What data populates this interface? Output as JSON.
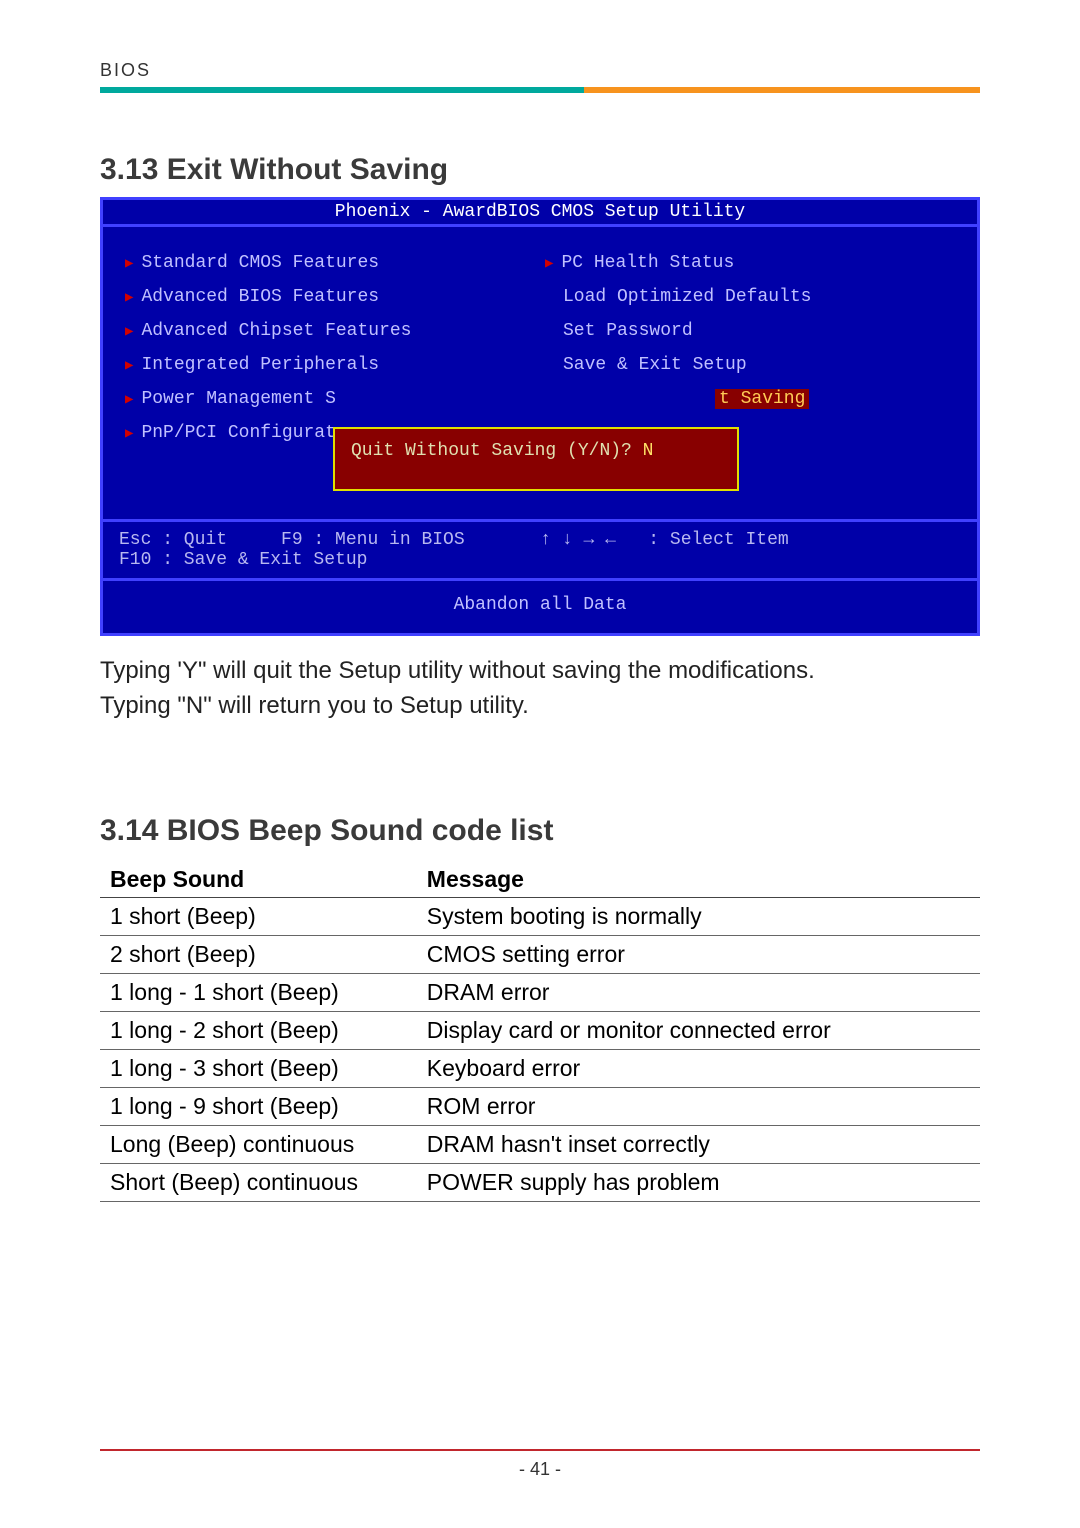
{
  "header": {
    "label": "BIOS"
  },
  "section1": {
    "title": "3.13 Exit Without Saving",
    "bios": {
      "title": "Phoenix - AwardBIOS CMOS Setup Utility",
      "left_items": [
        {
          "label": "Standard CMOS Features",
          "tri": true
        },
        {
          "label": "Advanced BIOS Features",
          "tri": true
        },
        {
          "label": "Advanced Chipset Features",
          "tri": true
        },
        {
          "label": "Integrated Peripherals",
          "tri": true
        },
        {
          "label": "Power Management S",
          "tri": true
        },
        {
          "label": "PnP/PCI Configurat",
          "tri": true
        }
      ],
      "right_items": [
        {
          "label": "PC Health Status",
          "tri": true
        },
        {
          "label": "Load Optimized Defaults",
          "tri": false
        },
        {
          "label": "Set Password",
          "tri": false
        },
        {
          "label": "Save & Exit Setup",
          "tri": false
        },
        {
          "label": "t Saving",
          "tri": false,
          "highlight": true
        }
      ],
      "popup_text": "Quit Without Saving (Y/N)?",
      "popup_answer": "N",
      "help_line1": "Esc : Quit     F9 : Menu in BIOS       ↑ ↓ → ←   : Select Item",
      "help_line2": "F10 : Save & Exit Setup",
      "footer": "Abandon all Data"
    },
    "body1": "Typing 'Y\" will quit the Setup utility without saving the modifications.",
    "body2": "Typing \"N\" will return you to Setup utility."
  },
  "section2": {
    "title": "3.14 BIOS Beep Sound code list",
    "headers": {
      "c1": "Beep Sound",
      "c2": "Message"
    },
    "rows": [
      {
        "sound": "1 short (Beep)",
        "msg": "System booting is normally"
      },
      {
        "sound": "2 short (Beep)",
        "msg": "CMOS setting error"
      },
      {
        "sound": "1 long - 1 short (Beep)",
        "msg": "DRAM error"
      },
      {
        "sound": "1 long - 2 short (Beep)",
        "msg": "Display card or monitor connected error"
      },
      {
        "sound": "1 long - 3 short (Beep)",
        "msg": "Keyboard error"
      },
      {
        "sound": "1 long - 9 short (Beep)",
        "msg": "ROM error"
      },
      {
        "sound": "Long (Beep) continuous",
        "msg": "DRAM hasn't inset correctly"
      },
      {
        "sound": "Short (Beep) continuous",
        "msg": "POWER supply has problem"
      }
    ]
  },
  "page_number": "41",
  "chart_data": {
    "type": "table",
    "title": "BIOS Beep Sound code list",
    "columns": [
      "Beep Sound",
      "Message"
    ],
    "rows": [
      [
        "1 short (Beep)",
        "System booting is normally"
      ],
      [
        "2 short (Beep)",
        "CMOS setting error"
      ],
      [
        "1 long - 1 short (Beep)",
        "DRAM error"
      ],
      [
        "1 long - 2 short (Beep)",
        "Display card or monitor connected error"
      ],
      [
        "1 long - 3 short (Beep)",
        "Keyboard error"
      ],
      [
        "1 long - 9 short (Beep)",
        "ROM error"
      ],
      [
        "Long (Beep) continuous",
        "DRAM hasn't inset correctly"
      ],
      [
        "Short (Beep) continuous",
        "POWER supply has problem"
      ]
    ]
  }
}
